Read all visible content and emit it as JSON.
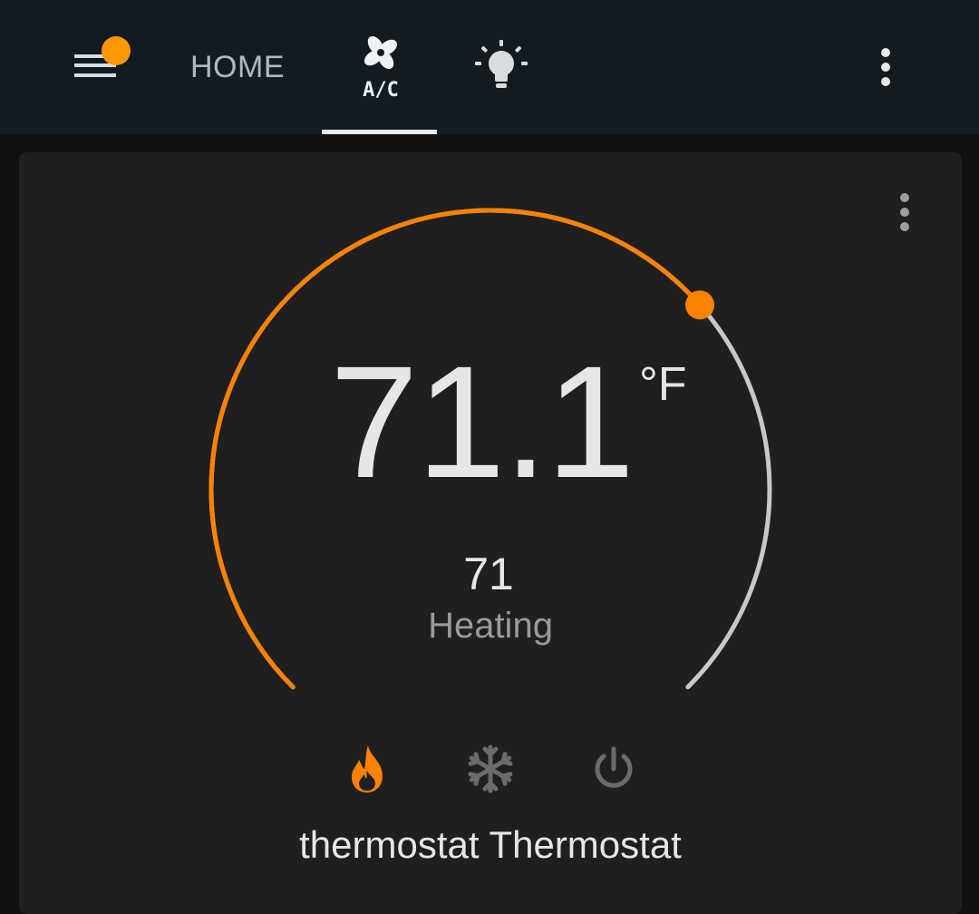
{
  "header": {
    "tabs": [
      {
        "id": "home",
        "label": "HOME"
      },
      {
        "id": "ac",
        "label": "A/C",
        "icon": "fan-icon",
        "active": true
      },
      {
        "id": "lights",
        "icon": "lightbulb-icon"
      }
    ],
    "menu_icon": "hamburger-menu-icon",
    "notification_color": "#ff9800",
    "overflow_icon": "more-vertical-icon"
  },
  "thermostat": {
    "current_temperature": "71.1",
    "unit": "°F",
    "target_temperature": "71",
    "hvac_action": "Heating",
    "name": "thermostat Thermostat",
    "modes": [
      {
        "id": "heat",
        "icon": "fire-icon",
        "active": true,
        "color": "#ff8100"
      },
      {
        "id": "cool",
        "icon": "snowflake-icon",
        "active": false,
        "color": "#6b6b6b"
      },
      {
        "id": "off",
        "icon": "power-icon",
        "active": false,
        "color": "#6b6b6b"
      }
    ],
    "slider_value_fraction": 0.68,
    "colors": {
      "active_arc": "#ff8100",
      "inactive_arc": "#c8c8c8",
      "card_bg": "#1f1f1f",
      "header_bg": "#111b21"
    }
  }
}
